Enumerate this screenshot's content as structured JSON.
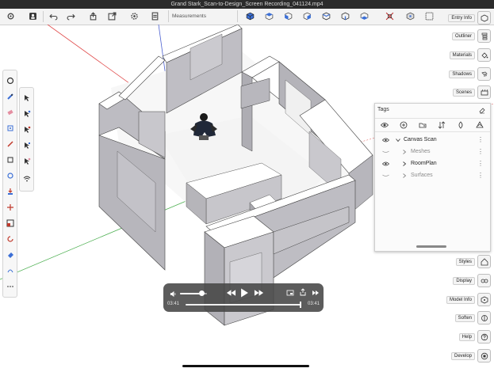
{
  "window": {
    "title": "Grand Stark_Scan-to-Design_Screen Recording_041124.mp4"
  },
  "toolbar": {
    "measurements_label": "Measurements",
    "left_icons": [
      "gear-icon",
      "user-icon",
      "undo-icon",
      "redo-icon",
      "export-icon",
      "share-icon",
      "settings-icon",
      "document-icon"
    ],
    "right_icons": [
      "cube-view-icon",
      "top-view-icon",
      "front-view-icon",
      "side-view-icon",
      "iso-view-icon",
      "back-view-icon",
      "bottom-view-icon",
      "perspective-icon",
      "section-icon",
      "xray-icon",
      "grid-icon"
    ]
  },
  "right_panel": {
    "top_buttons": [
      "Entry Info",
      "Outliner",
      "Materials",
      "Shadows",
      "Scenes"
    ],
    "bottom_buttons": [
      "Styles",
      "Display",
      "Model Info",
      "Soften",
      "Help",
      "Develop"
    ]
  },
  "tags_panel": {
    "title": "Tags",
    "rows": [
      {
        "name": "Canvas Scan",
        "visible": true,
        "expanded": true,
        "level": 0
      },
      {
        "name": "Meshes",
        "visible": false,
        "expanded": false,
        "level": 1
      },
      {
        "name": "RoomPlan",
        "visible": true,
        "expanded": false,
        "level": 1
      },
      {
        "name": "Surfaces",
        "visible": false,
        "expanded": false,
        "level": 1
      }
    ]
  },
  "player": {
    "current_time": "03:41",
    "total_time": "03:41",
    "volume_level": 0.8,
    "progress": 1.0
  },
  "colors": {
    "toolbar_bg": "#f3f3f3",
    "wall_top": "#ffffff",
    "wall_side": "#b9b7bd",
    "floor": "#f6f6f6",
    "axis_green": "#4caf50",
    "axis_red": "#e04848",
    "axis_blue": "#4a5fd0"
  }
}
